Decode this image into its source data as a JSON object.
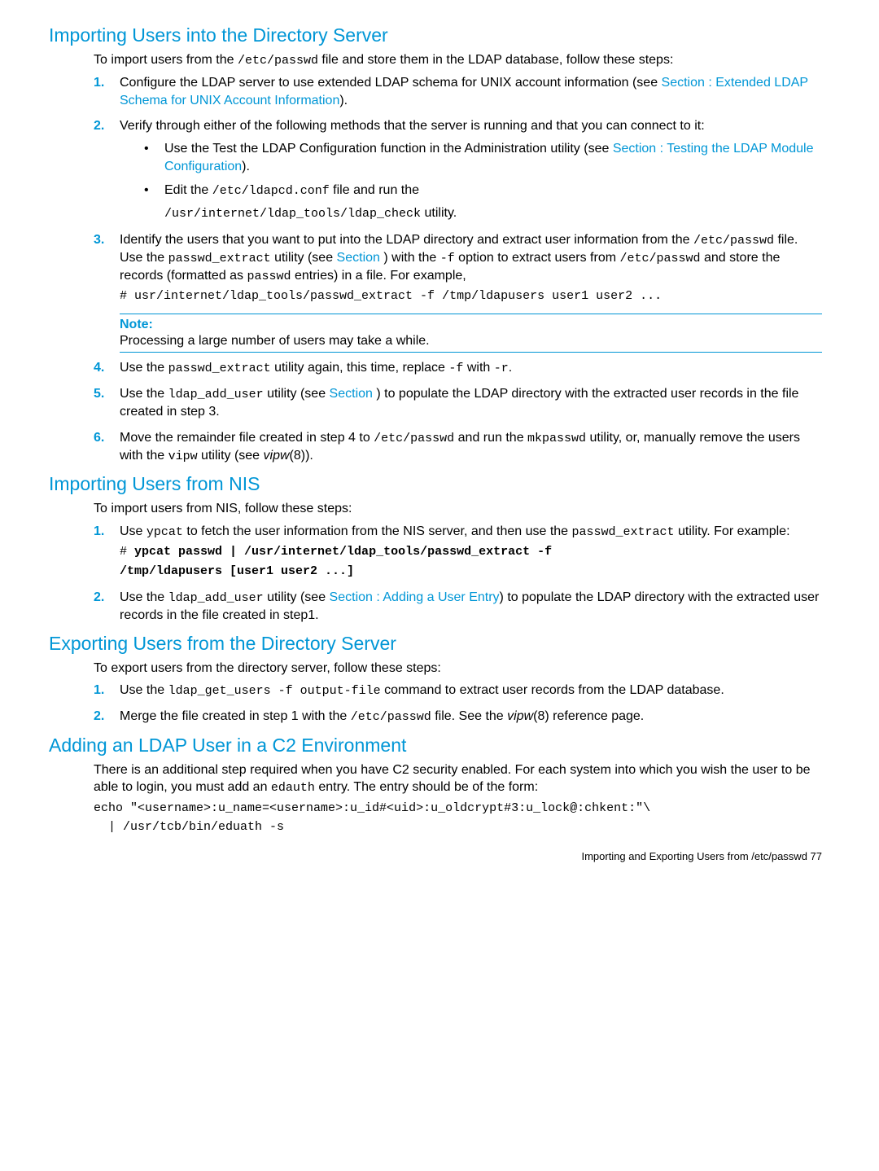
{
  "sec1": {
    "heading": "Importing Users into the Directory Server",
    "intro_1": "To import users from the ",
    "intro_code1": "/etc/passwd",
    "intro_2": " file and store them in the LDAP database, follow these steps:",
    "step1_a": "Configure the LDAP server to use extended LDAP schema for UNIX account information (see ",
    "step1_link": "Section : Extended LDAP Schema for UNIX Account Information",
    "step1_b": ").",
    "step2_a": "Verify through either of the following methods that the server is running and that you can connect to it:",
    "step2_b1a": "Use the Test the LDAP Configuration function in the Administration utility (see ",
    "step2_b1link": "Section : Testing the LDAP Module Configuration",
    "step2_b1b": ").",
    "step2_b2a": "Edit the ",
    "step2_b2c1": "/etc/ldapcd.conf",
    "step2_b2b": " file and run the",
    "step2_b2c2": "/usr/internet/ldap_tools/ldap_check",
    "step2_b2d": " utility.",
    "step3_a": "Identify the users that you want to put into the LDAP directory and extract user information from the ",
    "step3_c1": "/etc/passwd",
    "step3_b": " file. Use the ",
    "step3_c2": "passwd_extract",
    "step3_c": " utility (see ",
    "step3_link": "Section ",
    "step3_d": ") with the ",
    "step3_c3": "-f",
    "step3_e": " option to extract users from ",
    "step3_c4": "/etc/passwd",
    "step3_f": " and store the records (formatted as ",
    "step3_c5": "passwd",
    "step3_g": " entries) in a file. For example,",
    "step3_code": "# usr/internet/ldap_tools/passwd_extract -f /tmp/ldapusers user1 user2 ...",
    "note_label": "Note:",
    "note_text": "Processing a large number of users may take a while.",
    "step4_a": "Use the ",
    "step4_c1": "passwd_extract",
    "step4_b": " utility again, this time, replace ",
    "step4_c2": "-f",
    "step4_c": " with ",
    "step4_c3": "-r",
    "step4_d": ".",
    "step5_a": "Use the ",
    "step5_c1": "ldap_add_user",
    "step5_b": " utility (see ",
    "step5_link": "Section ",
    "step5_c": ") to populate the LDAP directory with the extracted user records in the file created in step 3.",
    "step6_a": "Move the remainder file created in step 4 to ",
    "step6_c1": "/etc/passwd",
    "step6_b": " and run the ",
    "step6_c2": "mkpasswd",
    "step6_c": " utility, or, manually remove the users with the ",
    "step6_c3": "vipw",
    "step6_d": " utility (see ",
    "step6_i": "vipw",
    "step6_e": "(8))."
  },
  "sec2": {
    "heading": "Importing Users from NIS",
    "intro": "To import users from NIS, follow these steps:",
    "step1_a": "Use ",
    "step1_c1": "ypcat",
    "step1_b": " to fetch the user information from the NIS server, and then use the ",
    "step1_c2": "passwd_extract",
    "step1_c": " utility. For example:",
    "step1_code1a": "# ",
    "step1_code1b": "ypcat passwd | /usr/internet/ldap_tools/passwd_extract -f",
    "step1_code2": "/tmp/ldapusers [user1 user2 ...]",
    "step2_a": "Use the ",
    "step2_c1": "ldap_add_user",
    "step2_b": " utility (see ",
    "step2_link": "Section : Adding a User Entry",
    "step2_c": ") to populate the LDAP directory with the extracted user records in the file created in step1."
  },
  "sec3": {
    "heading": "Exporting Users from the Directory Server",
    "intro": "To export users from the directory server, follow these steps:",
    "step1_a": "Use the ",
    "step1_c1": "ldap_get_users -f output-file",
    "step1_b": " command to extract user records from the LDAP database.",
    "step2_a": "Merge the file created in step 1 with the ",
    "step2_c1": "/etc/passwd",
    "step2_b": " file. See the ",
    "step2_i": "vipw",
    "step2_c": "(8) reference page."
  },
  "sec4": {
    "heading": "Adding an LDAP User in a C2 Environment",
    "intro_a": "There is an additional step required when you have C2 security enabled. For each system into which you wish the user to be able to login, you must add an ",
    "intro_c1": "edauth",
    "intro_b": " entry. The entry should be of the form:",
    "code1": "echo \"<username>:u_name=<username>:u_id#<uid>:u_oldcrypt#3:u_lock@:chkent:\"\\",
    "code2": "  | /usr/tcb/bin/eduath -s"
  },
  "footer": "Importing and Exporting Users from /etc/passwd    77"
}
